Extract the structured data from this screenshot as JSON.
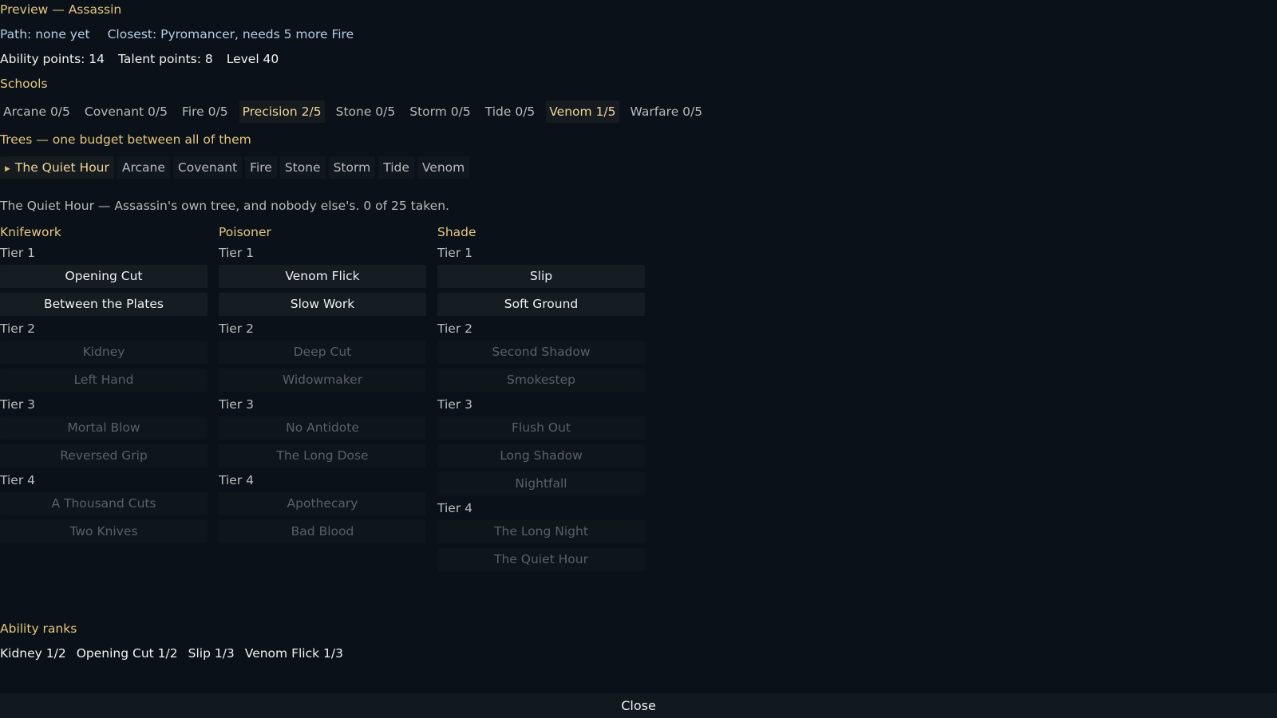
{
  "header": {
    "title": "Preview — Assassin",
    "path": "Path: none yet",
    "closest": "Closest: Pyromancer, needs 5 more Fire",
    "ability_points": "Ability points: 14",
    "talent_points": "Talent points: 8",
    "level": "Level 40"
  },
  "schools": {
    "heading": "Schools",
    "items": [
      {
        "label": "Arcane 0/5",
        "active": false
      },
      {
        "label": "Covenant 0/5",
        "active": false
      },
      {
        "label": "Fire 0/5",
        "active": false
      },
      {
        "label": "Precision 2/5",
        "active": true
      },
      {
        "label": "Stone 0/5",
        "active": false
      },
      {
        "label": "Storm 0/5",
        "active": false
      },
      {
        "label": "Tide 0/5",
        "active": false
      },
      {
        "label": "Venom 1/5",
        "active": true
      },
      {
        "label": "Warfare 0/5",
        "active": false
      }
    ]
  },
  "trees": {
    "heading": "Trees — one budget between all of them",
    "selected_icon": "triangle-right-icon",
    "tabs": [
      {
        "label": "The Quiet Hour",
        "selected": true
      },
      {
        "label": "Arcane",
        "selected": false
      },
      {
        "label": "Covenant",
        "selected": false
      },
      {
        "label": "Fire",
        "selected": false
      },
      {
        "label": "Stone",
        "selected": false
      },
      {
        "label": "Storm",
        "selected": false
      },
      {
        "label": "Tide",
        "selected": false
      },
      {
        "label": "Venom",
        "selected": false
      }
    ],
    "description": "The Quiet Hour — Assassin's own tree, and nobody else's. 0 of 25 taken."
  },
  "branches": [
    {
      "name": "Knifework",
      "tiers": [
        {
          "label": "Tier 1",
          "talents": [
            {
              "name": "Opening Cut",
              "unlocked": true
            },
            {
              "name": "Between the Plates",
              "unlocked": true
            }
          ]
        },
        {
          "label": "Tier 2",
          "talents": [
            {
              "name": "Kidney",
              "unlocked": false
            },
            {
              "name": "Left Hand",
              "unlocked": false
            }
          ]
        },
        {
          "label": "Tier 3",
          "talents": [
            {
              "name": "Mortal Blow",
              "unlocked": false
            },
            {
              "name": "Reversed Grip",
              "unlocked": false
            }
          ]
        },
        {
          "label": "Tier 4",
          "talents": [
            {
              "name": "A Thousand Cuts",
              "unlocked": false
            },
            {
              "name": "Two Knives",
              "unlocked": false
            }
          ]
        }
      ]
    },
    {
      "name": "Poisoner",
      "tiers": [
        {
          "label": "Tier 1",
          "talents": [
            {
              "name": "Venom Flick",
              "unlocked": true
            },
            {
              "name": "Slow Work",
              "unlocked": true
            }
          ]
        },
        {
          "label": "Tier 2",
          "talents": [
            {
              "name": "Deep Cut",
              "unlocked": false
            },
            {
              "name": "Widowmaker",
              "unlocked": false
            }
          ]
        },
        {
          "label": "Tier 3",
          "talents": [
            {
              "name": "No Antidote",
              "unlocked": false
            },
            {
              "name": "The Long Dose",
              "unlocked": false
            }
          ]
        },
        {
          "label": "Tier 4",
          "talents": [
            {
              "name": "Apothecary",
              "unlocked": false
            },
            {
              "name": "Bad Blood",
              "unlocked": false
            }
          ]
        }
      ]
    },
    {
      "name": "Shade",
      "tiers": [
        {
          "label": "Tier 1",
          "talents": [
            {
              "name": "Slip",
              "unlocked": true
            },
            {
              "name": "Soft Ground",
              "unlocked": true
            }
          ]
        },
        {
          "label": "Tier 2",
          "talents": [
            {
              "name": "Second Shadow",
              "unlocked": false
            },
            {
              "name": "Smokestep",
              "unlocked": false
            }
          ]
        },
        {
          "label": "Tier 3",
          "talents": [
            {
              "name": "Flush Out",
              "unlocked": false
            },
            {
              "name": "Long Shadow",
              "unlocked": false
            },
            {
              "name": "Nightfall",
              "unlocked": false
            }
          ]
        },
        {
          "label": "Tier 4",
          "talents": [
            {
              "name": "The Long Night",
              "unlocked": false
            },
            {
              "name": "The Quiet Hour",
              "unlocked": false
            }
          ]
        }
      ]
    }
  ],
  "ability_ranks": {
    "heading": "Ability ranks",
    "items": [
      "Kidney 1/2",
      "Opening Cut 1/2",
      "Slip 1/3",
      "Venom Flick 1/3"
    ]
  },
  "footer": {
    "close_label": "Close"
  },
  "colors": {
    "background": "#0a1118",
    "heading_gold": "#e6c77d",
    "path_blue": "#b4cde6",
    "locked_text": "#5a6066"
  }
}
